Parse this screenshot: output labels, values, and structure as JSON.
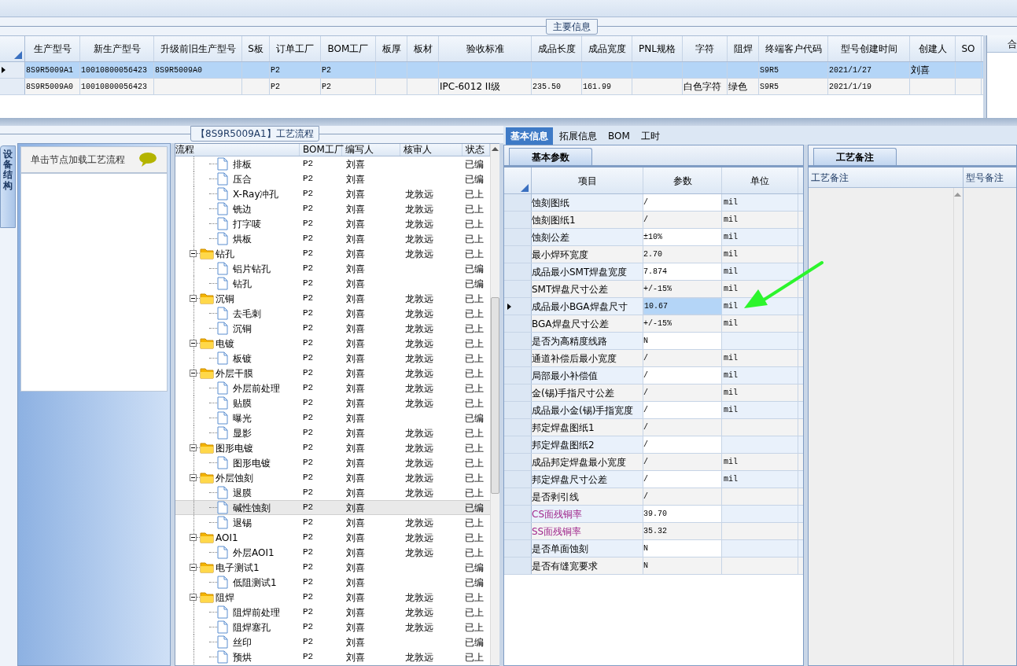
{
  "main_info": {
    "title": "主要信息",
    "columns": [
      "生产型号",
      "新生产型号",
      "升级前旧生产型号",
      "S板",
      "订单工厂",
      "BOM工厂",
      "板厚",
      "板材",
      "验收标准",
      "成品长度",
      "成品宽度",
      "PNL规格",
      "字符",
      "阻焊",
      "终端客户代码",
      "型号创建时间",
      "创建人",
      "SO"
    ],
    "rows": [
      {
        "selected": true,
        "cells": [
          "8S9R5009A1",
          "10010800056423",
          "8S9R5009A0",
          null,
          "P2",
          "P2",
          null,
          null,
          null,
          null,
          null,
          null,
          null,
          null,
          "S9R5",
          "2021/1/27",
          "刘喜",
          null
        ]
      },
      {
        "selected": false,
        "cells": [
          "8S9R5009A0",
          "10010800056423",
          null,
          null,
          "P2",
          "P2",
          null,
          null,
          "IPC-6012 II级",
          "235.50",
          "161.99",
          null,
          "白色字符",
          "绿色",
          "S9R5",
          "2021/1/19",
          null,
          null
        ]
      }
    ],
    "side_header": "合"
  },
  "side_tab": "设备结构",
  "equipment_panel": {
    "hint": "单击节点加载工艺流程"
  },
  "process": {
    "title": "【8S9R5009A1】工艺流程",
    "columns": [
      "流程",
      "BOM工厂",
      "编写人",
      "核审人",
      "状态"
    ],
    "tree": [
      {
        "kind": "step",
        "name": "排板",
        "factory": "P2",
        "writer": "刘喜",
        "status": "已编",
        "selected": false
      },
      {
        "kind": "step",
        "name": "压合",
        "factory": "P2",
        "writer": "刘喜",
        "status": "已编",
        "selected": false
      },
      {
        "kind": "step",
        "name": "X-Ray冲孔",
        "factory": "P2",
        "writer": "刘喜",
        "reviewer": "龙敦远",
        "status": "已上",
        "selected": false
      },
      {
        "kind": "step",
        "name": "铣边",
        "factory": "P2",
        "writer": "刘喜",
        "reviewer": "龙敦远",
        "status": "已上",
        "selected": false
      },
      {
        "kind": "step",
        "name": "打字唛",
        "factory": "P2",
        "writer": "刘喜",
        "reviewer": "龙敦远",
        "status": "已上",
        "selected": false
      },
      {
        "kind": "step",
        "name": "烘板",
        "factory": "P2",
        "writer": "刘喜",
        "reviewer": "龙敦远",
        "status": "已上",
        "selected": false
      },
      {
        "kind": "group",
        "name": "钻孔",
        "factory": "P2",
        "writer": "刘喜",
        "reviewer": "龙敦远",
        "status": "已上",
        "selected": false,
        "expanded": true,
        "children": [
          {
            "kind": "step",
            "name": "铝片钻孔",
            "factory": "P2",
            "writer": "刘喜",
            "status": "已编",
            "selected": false
          },
          {
            "kind": "step",
            "name": "钻孔",
            "factory": "P2",
            "writer": "刘喜",
            "status": "已编",
            "selected": false
          }
        ]
      },
      {
        "kind": "group",
        "name": "沉铜",
        "factory": "P2",
        "writer": "刘喜",
        "reviewer": "龙敦远",
        "status": "已上",
        "selected": false,
        "expanded": true,
        "children": [
          {
            "kind": "step",
            "name": "去毛刺",
            "factory": "P2",
            "writer": "刘喜",
            "reviewer": "龙敦远",
            "status": "已上",
            "selected": false
          },
          {
            "kind": "step",
            "name": "沉铜",
            "factory": "P2",
            "writer": "刘喜",
            "reviewer": "龙敦远",
            "status": "已上",
            "selected": false
          }
        ]
      },
      {
        "kind": "group",
        "name": "电镀",
        "factory": "P2",
        "writer": "刘喜",
        "reviewer": "龙敦远",
        "status": "已上",
        "selected": false,
        "expanded": true,
        "children": [
          {
            "kind": "step",
            "name": "板镀",
            "factory": "P2",
            "writer": "刘喜",
            "reviewer": "龙敦远",
            "status": "已上",
            "selected": false
          }
        ]
      },
      {
        "kind": "group",
        "name": "外层干膜",
        "factory": "P2",
        "writer": "刘喜",
        "reviewer": "龙敦远",
        "status": "已上",
        "selected": false,
        "expanded": true,
        "children": [
          {
            "kind": "step",
            "name": "外层前处理",
            "factory": "P2",
            "writer": "刘喜",
            "reviewer": "龙敦远",
            "status": "已上",
            "selected": false
          },
          {
            "kind": "step",
            "name": "贴膜",
            "factory": "P2",
            "writer": "刘喜",
            "reviewer": "龙敦远",
            "status": "已上",
            "selected": false
          },
          {
            "kind": "step",
            "name": "曝光",
            "factory": "P2",
            "writer": "刘喜",
            "status": "已编",
            "selected": false
          },
          {
            "kind": "step",
            "name": "显影",
            "factory": "P2",
            "writer": "刘喜",
            "reviewer": "龙敦远",
            "status": "已上",
            "selected": false
          }
        ]
      },
      {
        "kind": "group",
        "name": "图形电镀",
        "factory": "P2",
        "writer": "刘喜",
        "reviewer": "龙敦远",
        "status": "已上",
        "selected": false,
        "expanded": true,
        "children": [
          {
            "kind": "step",
            "name": "图形电镀",
            "factory": "P2",
            "writer": "刘喜",
            "reviewer": "龙敦远",
            "status": "已上",
            "selected": false
          }
        ]
      },
      {
        "kind": "group",
        "name": "外层蚀刻",
        "factory": "P2",
        "writer": "刘喜",
        "reviewer": "龙敦远",
        "status": "已上",
        "selected": false,
        "expanded": true,
        "children": [
          {
            "kind": "step",
            "name": "退膜",
            "factory": "P2",
            "writer": "刘喜",
            "reviewer": "龙敦远",
            "status": "已上",
            "selected": false
          },
          {
            "kind": "step",
            "name": "碱性蚀刻",
            "factory": "P2",
            "writer": "刘喜",
            "status": "已编",
            "selected": true
          },
          {
            "kind": "step",
            "name": "退锡",
            "factory": "P2",
            "writer": "刘喜",
            "reviewer": "龙敦远",
            "status": "已上",
            "selected": false
          }
        ]
      },
      {
        "kind": "group",
        "name": "AOI1",
        "factory": "P2",
        "writer": "刘喜",
        "reviewer": "龙敦远",
        "status": "已上",
        "selected": false,
        "expanded": true,
        "children": [
          {
            "kind": "step",
            "name": "外层AOI1",
            "factory": "P2",
            "writer": "刘喜",
            "reviewer": "龙敦远",
            "status": "已上",
            "selected": false
          }
        ]
      },
      {
        "kind": "group",
        "name": "电子测试1",
        "factory": "P2",
        "writer": "刘喜",
        "status": "已编",
        "selected": false,
        "expanded": true,
        "children": [
          {
            "kind": "step",
            "name": "低阻测试1",
            "factory": "P2",
            "writer": "刘喜",
            "status": "已编",
            "selected": false
          }
        ]
      },
      {
        "kind": "group",
        "name": "阻焊",
        "factory": "P2",
        "writer": "刘喜",
        "reviewer": "龙敦远",
        "status": "已上",
        "selected": false,
        "expanded": true,
        "children": [
          {
            "kind": "step",
            "name": "阻焊前处理",
            "factory": "P2",
            "writer": "刘喜",
            "reviewer": "龙敦远",
            "status": "已上",
            "selected": false
          },
          {
            "kind": "step",
            "name": "阻焊塞孔",
            "factory": "P2",
            "writer": "刘喜",
            "reviewer": "龙敦远",
            "status": "已上",
            "selected": false
          },
          {
            "kind": "step",
            "name": "丝印",
            "factory": "P2",
            "writer": "刘喜",
            "status": "已编",
            "selected": false
          },
          {
            "kind": "step",
            "name": "预烘",
            "factory": "P2",
            "writer": "刘喜",
            "reviewer": "龙敦远",
            "status": "已上",
            "selected": false
          }
        ]
      }
    ]
  },
  "tabs": [
    {
      "label": "基本信息",
      "selected": true
    },
    {
      "label": "拓展信息",
      "selected": false
    },
    {
      "label": "BOM",
      "selected": false
    },
    {
      "label": "工时",
      "selected": false
    }
  ],
  "params": {
    "tab": "基本参数",
    "columns": [
      "项目",
      "参数",
      "单位"
    ],
    "rows": [
      {
        "item": "蚀刻图纸",
        "value": "/",
        "unit": "mil",
        "selected": false
      },
      {
        "item": "蚀刻图纸1",
        "value": "/",
        "unit": "mil",
        "selected": false
      },
      {
        "item": "蚀刻公差",
        "value": "±10%",
        "unit": "mil",
        "selected": false
      },
      {
        "item": "最小焊环宽度",
        "value": "2.70",
        "unit": "mil",
        "selected": false
      },
      {
        "item": "成品最小SMT焊盘宽度",
        "value": "7.874",
        "unit": "mil",
        "selected": false
      },
      {
        "item": "SMT焊盘尺寸公差",
        "value": "+/-15%",
        "unit": "mil",
        "selected": false
      },
      {
        "item": "成品最小BGA焊盘尺寸",
        "value": "10.67",
        "unit": "mil",
        "selected": true
      },
      {
        "item": "BGA焊盘尺寸公差",
        "value": "+/-15%",
        "unit": "mil",
        "selected": false
      },
      {
        "item": "是否为高精度线路",
        "value": "N",
        "selected": false
      },
      {
        "item": "通道补偿后最小宽度",
        "value": "/",
        "unit": "mil",
        "selected": false
      },
      {
        "item": "局部最小补偿值",
        "value": "/",
        "unit": "mil",
        "selected": false
      },
      {
        "item": "金(锡)手指尺寸公差",
        "value": "/",
        "unit": "mil",
        "selected": false
      },
      {
        "item": "成品最小金(锡)手指宽度",
        "value": "/",
        "unit": "mil",
        "selected": false
      },
      {
        "item": "邦定焊盘图纸1",
        "value": "/",
        "selected": false
      },
      {
        "item": "邦定焊盘图纸2",
        "value": "/",
        "selected": false
      },
      {
        "item": "成品邦定焊盘最小宽度",
        "value": "/",
        "unit": "mil",
        "selected": false
      },
      {
        "item": "邦定焊盘尺寸公差",
        "value": "/",
        "unit": "mil",
        "selected": false
      },
      {
        "item": "是否剥引线",
        "value": "/",
        "selected": false
      },
      {
        "item": "CS面残铜率",
        "value": "39.70",
        "color": "#a0288c",
        "selected": false
      },
      {
        "item": "SS面残铜率",
        "value": "35.32",
        "color": "#a0288c",
        "selected": false
      },
      {
        "item": "是否单面蚀刻",
        "value": "N",
        "selected": false
      },
      {
        "item": "是否有缝宽要求",
        "value": "N",
        "selected": false
      }
    ]
  },
  "notes": {
    "tab": "工艺备注",
    "columns": [
      "工艺备注",
      "型号备注"
    ]
  }
}
